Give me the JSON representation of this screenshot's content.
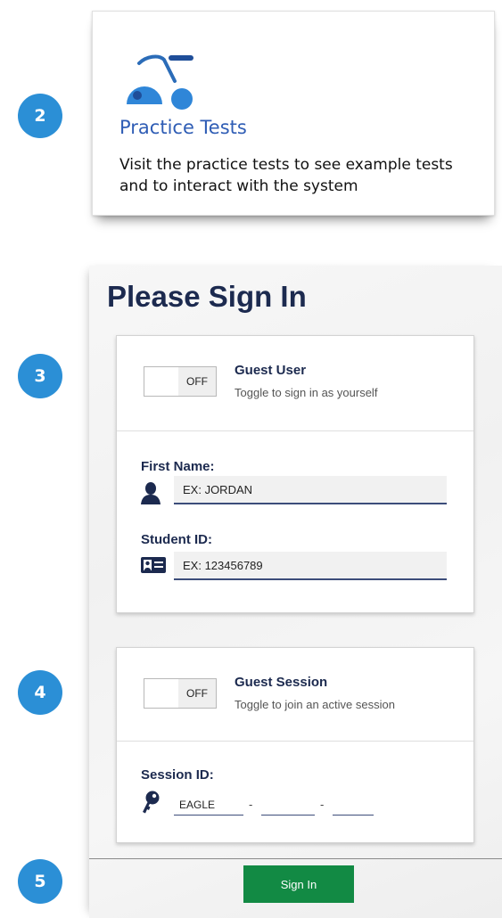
{
  "steps": [
    "2",
    "3",
    "4",
    "5"
  ],
  "practice": {
    "title": "Practice Tests",
    "description": "Visit the practice tests to see example tests and to interact with the system",
    "icon": "tricycle-icon",
    "accent": "#2b8fd6"
  },
  "signin": {
    "title": "Please Sign In",
    "guest_user": {
      "toggle_state": "OFF",
      "title": "Guest User",
      "subtitle": "Toggle to sign in as yourself"
    },
    "first_name": {
      "label": "First Name:",
      "placeholder": "EX: JORDAN",
      "icon": "person-icon"
    },
    "student_id": {
      "label": "Student ID:",
      "placeholder": "EX: 123456789",
      "icon": "id-card-icon"
    },
    "guest_session": {
      "toggle_state": "OFF",
      "title": "Guest Session",
      "subtitle": "Toggle to join an active session"
    },
    "session_id": {
      "label": "Session ID:",
      "icon": "key-icon",
      "segments": [
        "EAGLE",
        "",
        ""
      ],
      "separator": "-"
    },
    "button_label": "Sign In",
    "button_color": "#128a44",
    "heading_color": "#1c2a4f"
  }
}
